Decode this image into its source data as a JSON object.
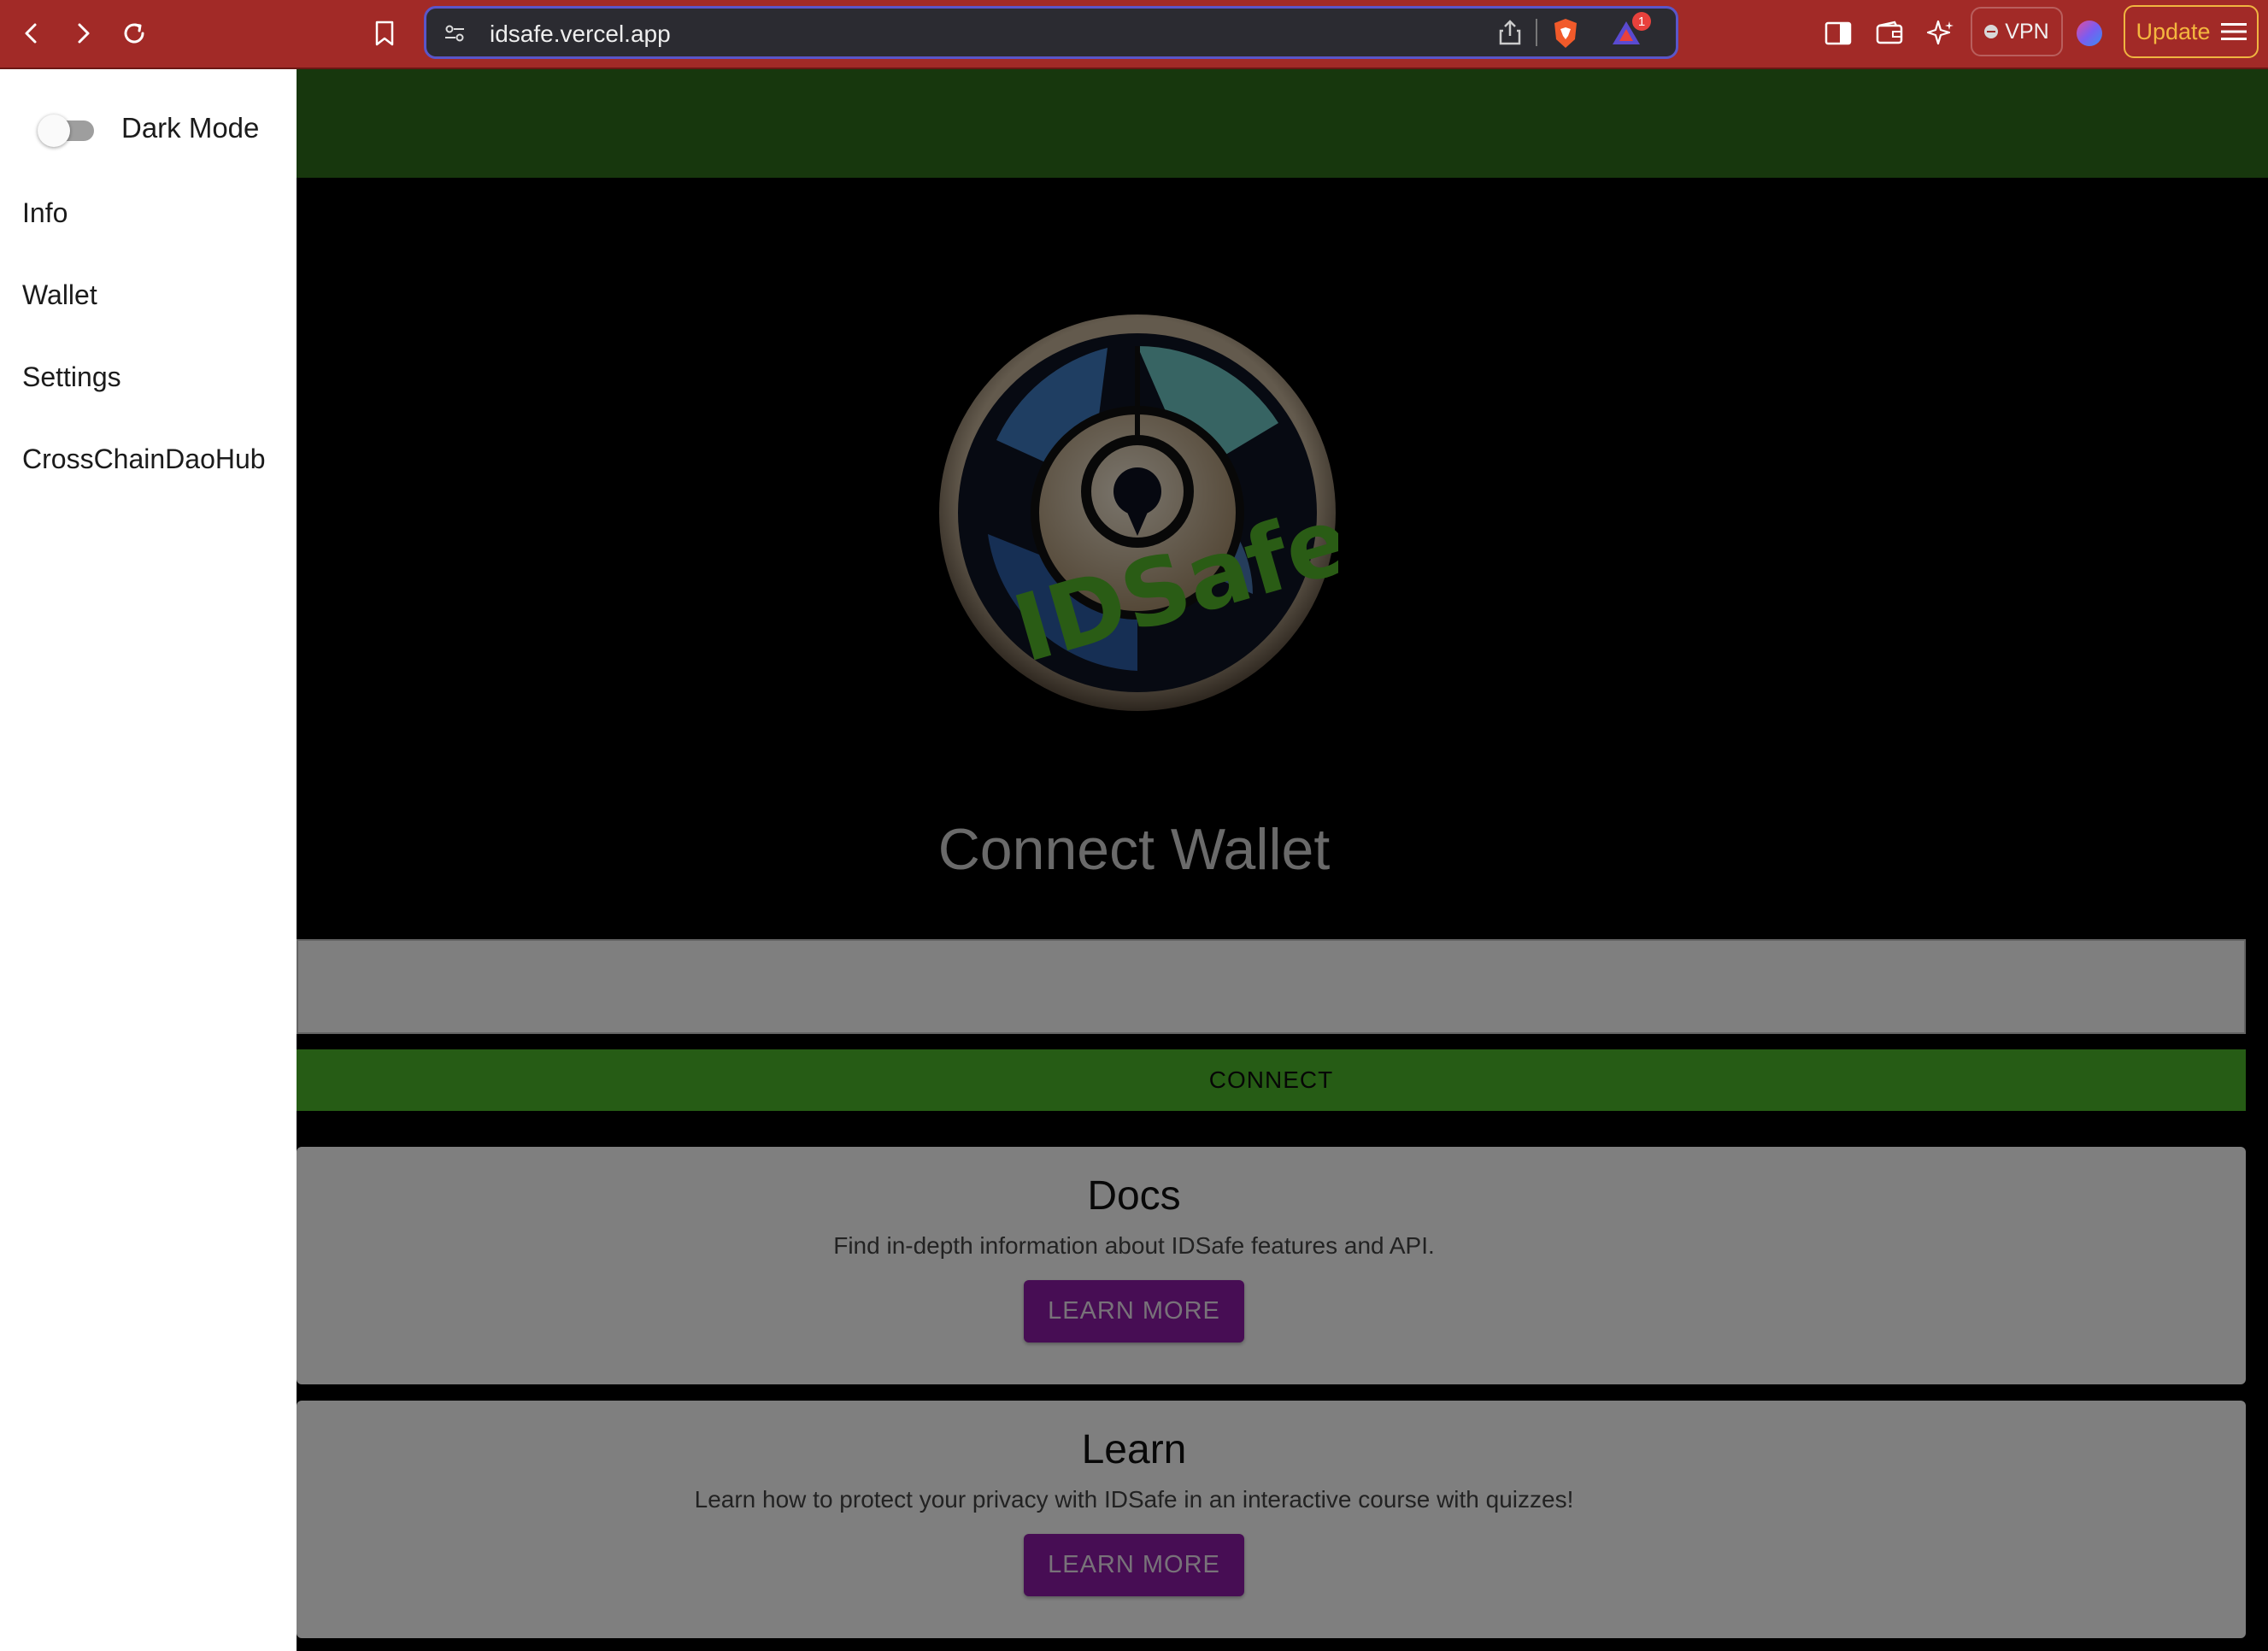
{
  "browser": {
    "url": "idsafe.vercel.app",
    "notification_count": "1",
    "vpn_label": "VPN",
    "update_label": "Update"
  },
  "drawer": {
    "dark_mode_label": "Dark Mode",
    "dark_mode_on": false,
    "items": [
      {
        "label": "Info"
      },
      {
        "label": "Wallet"
      },
      {
        "label": "Settings"
      },
      {
        "label": "CrossChainDaoHub"
      }
    ]
  },
  "hero": {
    "logo_text": "IDSafe",
    "title": "Connect Wallet"
  },
  "wallet": {
    "input_value": "",
    "connect_label": "CONNECT"
  },
  "cards": [
    {
      "title": "Docs",
      "description": "Find in-depth information about IDSafe features and API.",
      "button": "LEARN MORE"
    },
    {
      "title": "Learn",
      "description": "Learn how to protect your privacy with IDSafe in an interactive course with quizzes!",
      "button": "LEARN MORE"
    }
  ],
  "colors": {
    "browser_bar": "#a22a27",
    "header_green": "#2e6e1a",
    "connect_green": "#4cb82a",
    "button_purple": "#8e1aa8"
  }
}
